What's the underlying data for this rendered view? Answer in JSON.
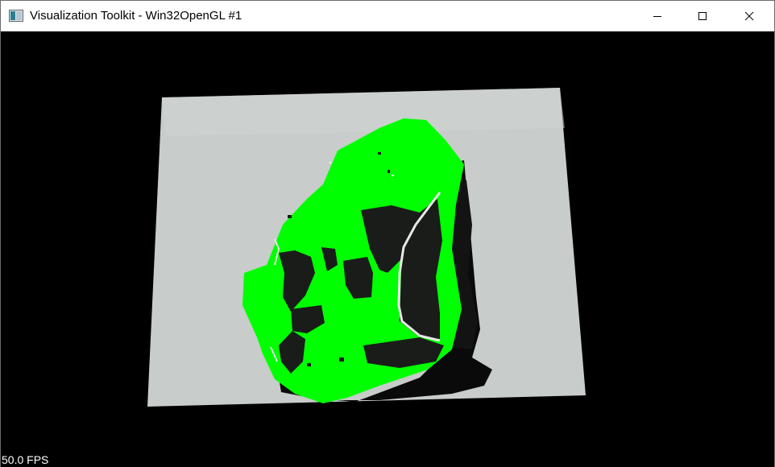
{
  "window": {
    "title": "Visualization Toolkit - Win32OpenGL #1",
    "app_icon": "vtk-window-icon",
    "controls": [
      "minimize-icon",
      "maximize-icon",
      "close-icon"
    ]
  },
  "viewport": {
    "fps_label": "50.0 FPS",
    "background_color": "#000000",
    "scene_colors": {
      "paper": "#c8ccca",
      "segmented_object": "#00ff00",
      "object_dark": "#1a1c1a"
    }
  }
}
